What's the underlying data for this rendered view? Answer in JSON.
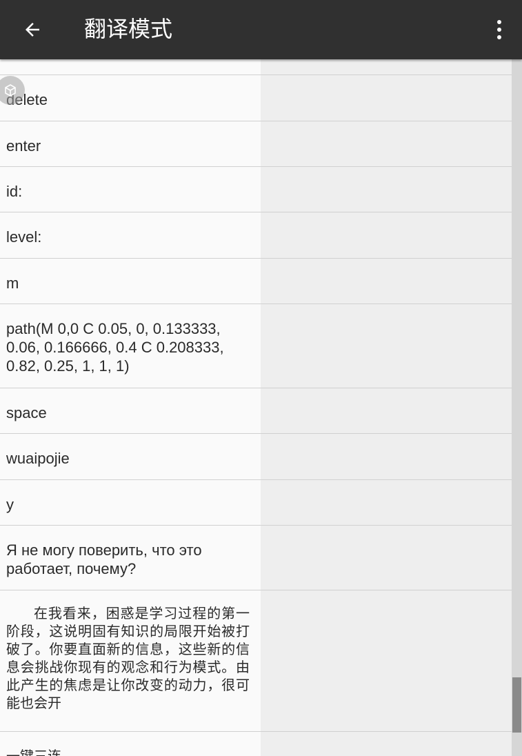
{
  "appbar": {
    "title": "翻译模式",
    "back_icon": "arrow-left-icon",
    "menu_icon": "more-vertical-icon"
  },
  "list": {
    "items": [
      {
        "text": "delete"
      },
      {
        "text": "enter"
      },
      {
        "text": "id:"
      },
      {
        "text": "level:"
      },
      {
        "text": "m"
      },
      {
        "text": "path(M 0,0 C 0.05, 0, 0.133333, 0.06, 0.166666, 0.4 C 0.208333, 0.82, 0.25, 1, 1, 1)"
      },
      {
        "text": "space"
      },
      {
        "text": "wuaipojie"
      },
      {
        "text": "y"
      },
      {
        "text": "Я не могу поверить, что это работает, почему?"
      },
      {
        "text": "在我看来，困惑是学习过程的第一阶段，这说明固有知识的局限开始被打破了。你要直面新的信息，这些新的信息会挑战你现有的观念和行为模式。由此产生的焦虑是让你改变的动力，很可能也会开"
      },
      {
        "text": "一键三连"
      }
    ]
  },
  "colors": {
    "appbar": "#303030",
    "left_column": "#fafafa",
    "right_column": "#eeeeee",
    "divider": "#d0d0d0",
    "scroll_thumb": "#8a8a8a"
  }
}
